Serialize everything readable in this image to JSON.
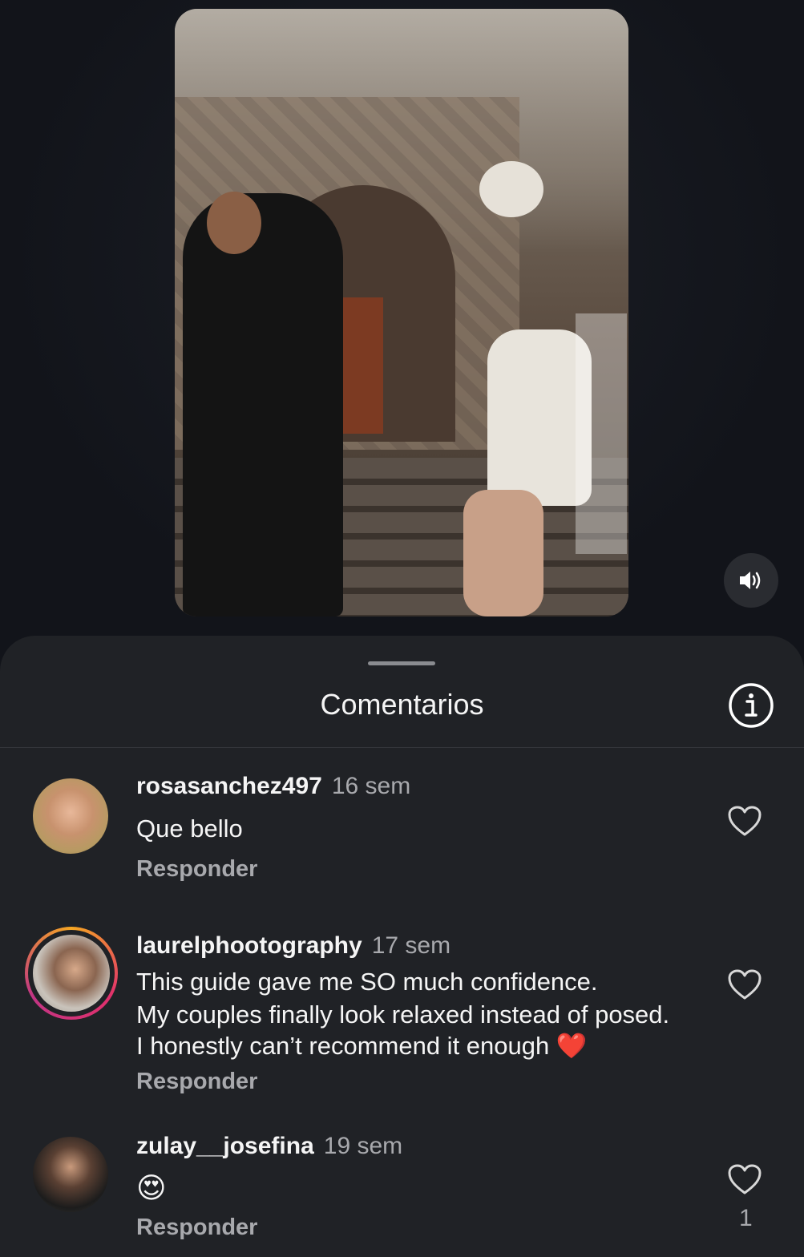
{
  "sheet": {
    "title": "Comentarios"
  },
  "icons": {
    "sound": "speaker-icon",
    "info": "info-icon",
    "like": "heart-icon"
  },
  "comments": [
    {
      "username": "rosasanchez497",
      "time": "16 sem",
      "lines": [
        "Que bello"
      ],
      "reply": "Responder"
    },
    {
      "username": "laurelphootography",
      "time": "17 sem",
      "lines": [
        "This guide gave me SO much confidence.",
        "My couples finally look relaxed instead of posed.",
        "I honestly can’t recommend it enough"
      ],
      "emoji": "❤️",
      "reply": "Responder"
    },
    {
      "username": "zulay__josefina",
      "time": "19 sem",
      "lines": [
        "😍"
      ],
      "reply": "Responder",
      "likes": "1"
    }
  ]
}
